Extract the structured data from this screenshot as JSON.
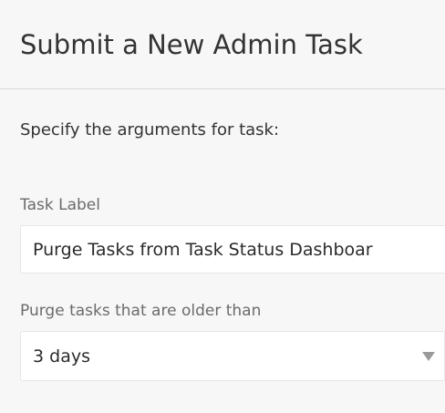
{
  "dialog": {
    "title": "Submit a New Admin Task",
    "intro": "Specify the arguments for task:"
  },
  "fields": {
    "task_label": {
      "label": "Task Label",
      "value": "Purge Tasks from Task Status Dashboar"
    },
    "purge_age": {
      "label": "Purge tasks that are older than",
      "selected": "3 days",
      "icon": "triangle-down-icon"
    }
  },
  "colors": {
    "background": "#f7f7f7",
    "field_background": "#ffffff",
    "field_border": "#e6e6e6",
    "label_text": "#6b6b6b",
    "chevron": "#9a9a9a"
  }
}
